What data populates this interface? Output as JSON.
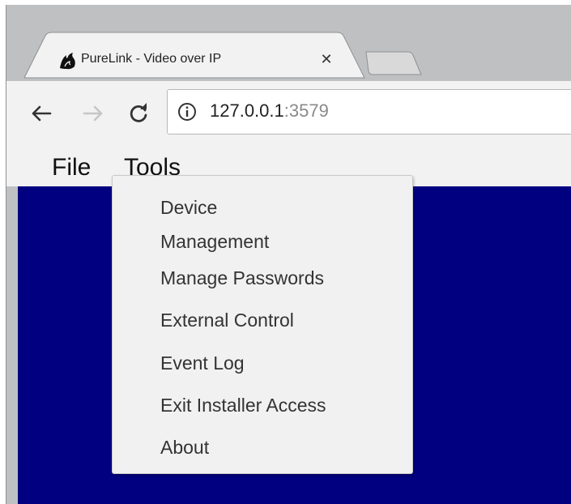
{
  "browser": {
    "tab": {
      "title": "PureLink - Video over IP",
      "close_glyph": "✕",
      "favicon": "purelink-logo-icon"
    },
    "toolbar": {
      "back_icon": "back-arrow-icon",
      "forward_icon": "forward-arrow-icon",
      "reload_icon": "reload-icon",
      "site_info_icon": "info-icon",
      "url_host": "127.0.0.1",
      "url_port": ":3579"
    }
  },
  "app": {
    "menubar": {
      "file_label": "File",
      "tools_label": "Tools"
    },
    "canvas_color": "#000080",
    "tools_menu": {
      "items": [
        {
          "label_line1": "Device",
          "label_line2": "Management"
        },
        {
          "label": "Manage Passwords"
        },
        {
          "label": "External Control"
        },
        {
          "label": "Event Log"
        },
        {
          "label": "Exit Installer Access"
        },
        {
          "label": "About"
        }
      ]
    }
  }
}
